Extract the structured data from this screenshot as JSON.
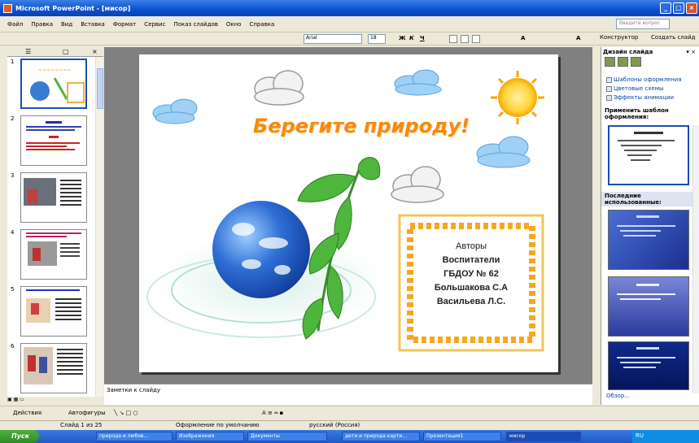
{
  "window": {
    "title": "Microsoft PowerPoint - [мисор]"
  },
  "menu": [
    "Файл",
    "Правка",
    "Вид",
    "Вставка",
    "Формат",
    "Сервис",
    "Показ слайдов",
    "Окно",
    "Справка"
  ],
  "help_placeholder": "Введите вопрос",
  "toolbar": {
    "font": "Arial",
    "size": "18",
    "designer": "Конструктор",
    "new_slide": "Создать слайд"
  },
  "slide": {
    "title": "Берегите природу!",
    "authors": [
      "Авторы",
      "Воспитатели",
      "ГБДОУ № 62",
      "Большакова С.А",
      "Васильева Л.С."
    ]
  },
  "notes_placeholder": "Заметки к слайду",
  "thumbnails": [
    "1",
    "2",
    "3",
    "4",
    "5",
    "6"
  ],
  "right_pane": {
    "title": "Дизайн слайда",
    "links": [
      "Шаблоны оформления",
      "Цветовые схемы",
      "Эффекты анимации"
    ],
    "apply_heading": "Применить шаблон оформления:",
    "recent_heading": "Последние использованные:",
    "browse": "Обзор..."
  },
  "drawbar": {
    "actions": "Действия",
    "autoshapes": "Автофигуры"
  },
  "status": {
    "slide": "Слайд 1 из 25",
    "design": "Оформление по умолчанию",
    "lang": "русский (Россия)"
  },
  "taskbar": {
    "start": "Пуск",
    "tasks": [
      "природа и любов...",
      "Изображения",
      "Документы",
      "дети и природа карти...",
      "Презентация1",
      "мисор"
    ],
    "tray": "RU"
  },
  "colors": {
    "title_orange": "#f58a10",
    "sky": "#cfe7fb",
    "leaf": "#4fb63d"
  }
}
